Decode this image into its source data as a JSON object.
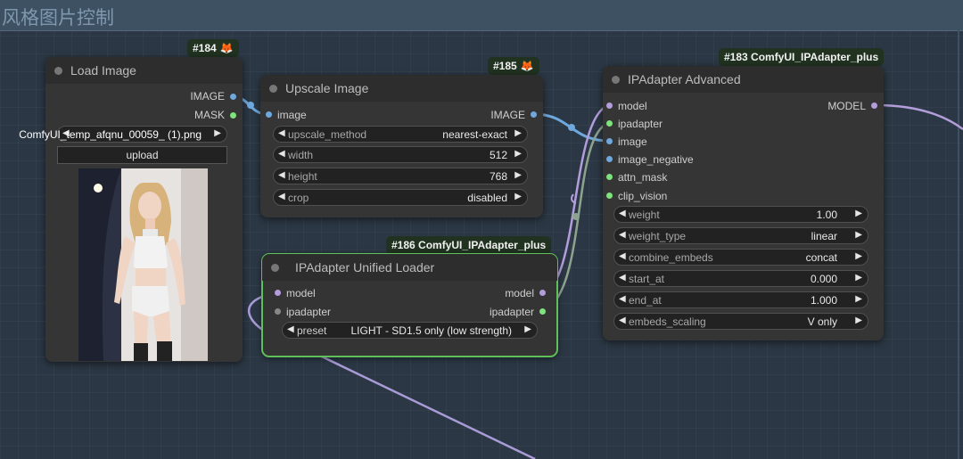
{
  "group": {
    "title": "风格图片控制"
  },
  "colors": {
    "image_slot": "#6fa8dc",
    "model_slot": "#b39ddb",
    "ipadapter_slot": "#7ee27e",
    "selected_outline": "#5fbf58",
    "badge_bg": "#213221"
  },
  "icons": {
    "badge_icon": "fox-icon",
    "left_arrow": "triangle-left-icon",
    "right_arrow": "triangle-right-icon"
  },
  "nodes": {
    "load_image": {
      "badge": "#184",
      "title": "Load Image",
      "outputs": [
        "IMAGE",
        "MASK"
      ],
      "image_value": "ComfyUI_temp_afqnu_00059_ (1).png",
      "upload_label": "upload"
    },
    "upscale_image": {
      "badge": "#185",
      "title": "Upscale Image",
      "input": "image",
      "output": "IMAGE",
      "widgets": [
        {
          "label": "upscale_method",
          "value": "nearest-exact"
        },
        {
          "label": "width",
          "value": "512"
        },
        {
          "label": "height",
          "value": "768"
        },
        {
          "label": "crop",
          "value": "disabled"
        }
      ]
    },
    "ipadapter_loader": {
      "badge": "#186 ComfyUI_IPAdapter_plus",
      "title": "IPAdapter Unified Loader",
      "inputs": [
        "model",
        "ipadapter"
      ],
      "outputs": [
        "model",
        "ipadapter"
      ],
      "preset_label": "preset",
      "preset_value": "LIGHT - SD1.5 only (low strength)"
    },
    "ipadapter_advanced": {
      "badge": "#183 ComfyUI_IPAdapter_plus",
      "title": "IPAdapter Advanced",
      "inputs": [
        "model",
        "ipadapter",
        "image",
        "image_negative",
        "attn_mask",
        "clip_vision"
      ],
      "output": "MODEL",
      "widgets": [
        {
          "label": "weight",
          "value": "1.00"
        },
        {
          "label": "weight_type",
          "value": "linear"
        },
        {
          "label": "combine_embeds",
          "value": "concat"
        },
        {
          "label": "start_at",
          "value": "0.000"
        },
        {
          "label": "end_at",
          "value": "1.000"
        },
        {
          "label": "embeds_scaling",
          "value": "V only"
        }
      ]
    }
  }
}
